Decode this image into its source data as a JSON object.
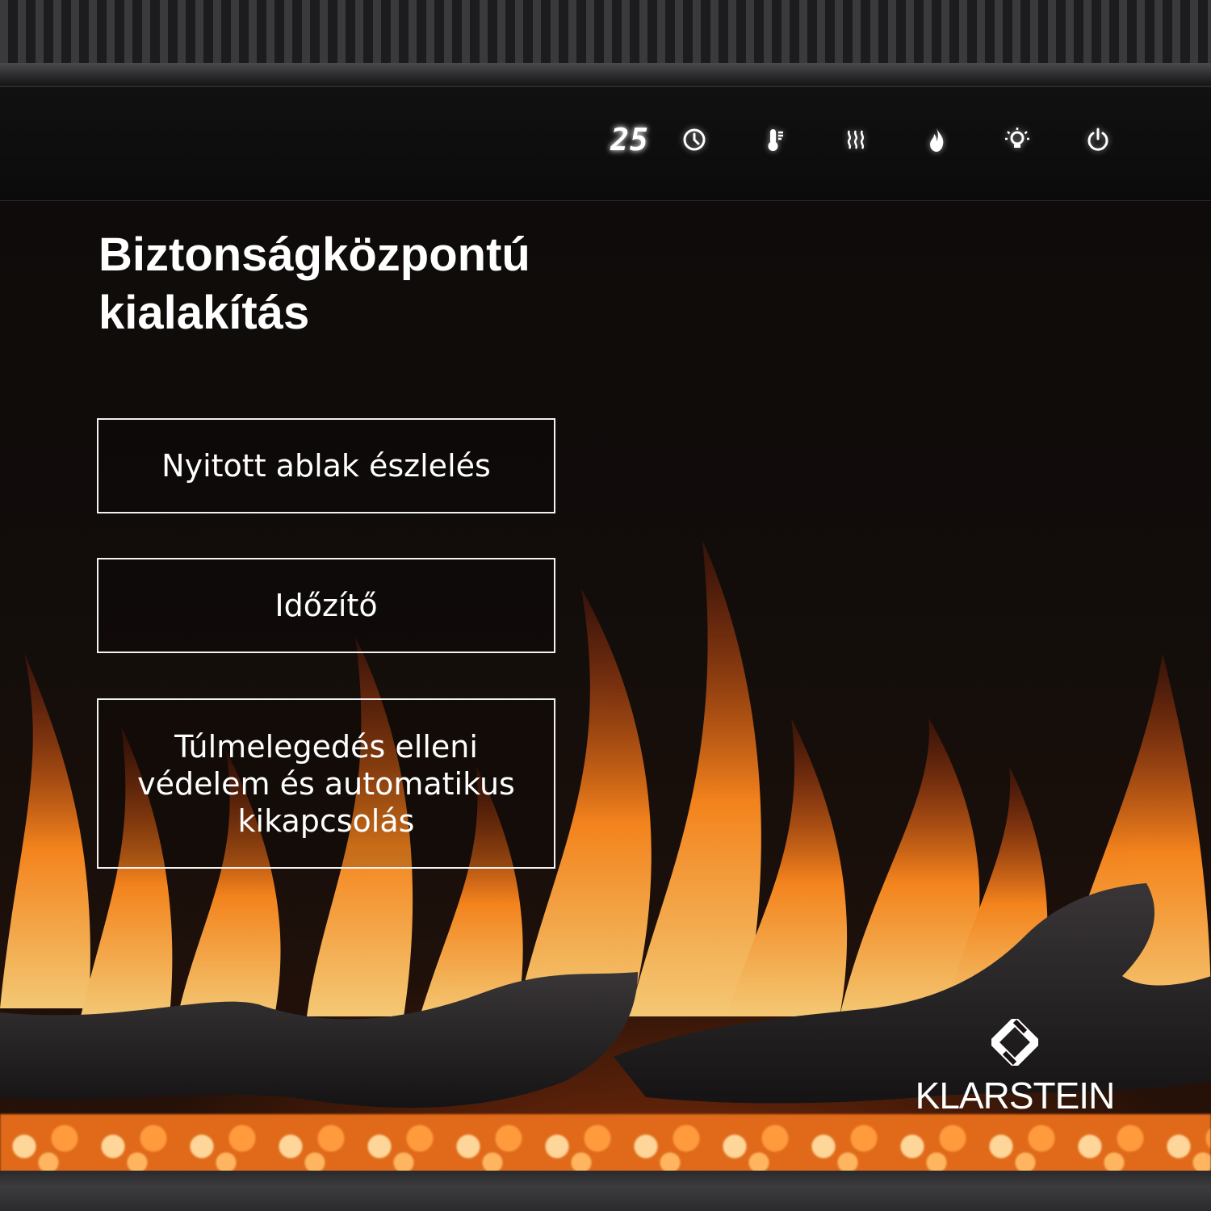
{
  "control_panel": {
    "temperature_display": "25",
    "buttons": [
      {
        "icon": "timer-icon"
      },
      {
        "icon": "thermometer-icon"
      },
      {
        "icon": "heat-waves-icon"
      },
      {
        "icon": "flame-icon"
      },
      {
        "icon": "light-bulb-icon"
      },
      {
        "icon": "power-icon"
      }
    ]
  },
  "heading": {
    "line1": "Biztonságközpontú",
    "line2": "kialakítás"
  },
  "features": [
    "Nyitott ablak észlelés",
    "Időzítő",
    "Túlmelegedés elleni védelem és automatikus kikapcsolás"
  ],
  "brand": {
    "name": "KLARSTEIN"
  },
  "colors": {
    "background": "#0d0a09",
    "flame_orange": "#ff7a1a",
    "flame_yellow": "#ffc34d",
    "text": "#ffffff"
  }
}
